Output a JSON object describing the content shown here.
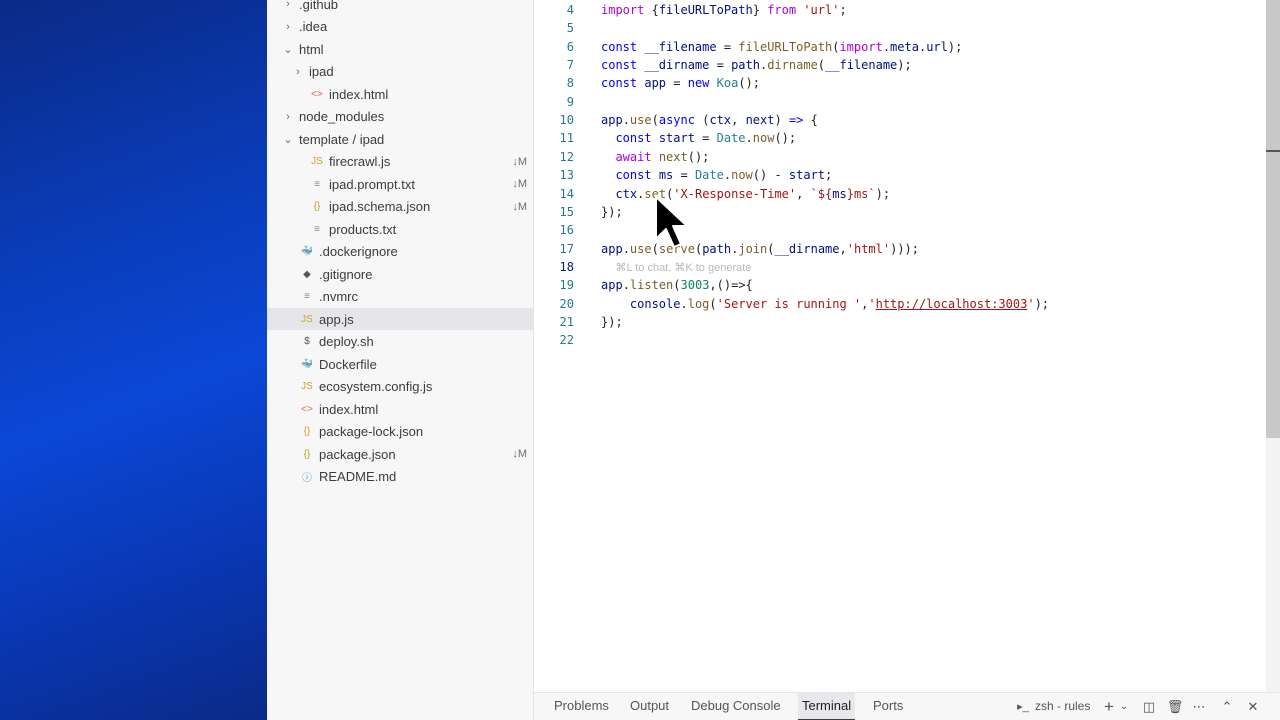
{
  "explorer": {
    "items": [
      {
        "label": ".github",
        "chev": "›",
        "icon": "",
        "status": "",
        "indent": 0
      },
      {
        "label": ".idea",
        "chev": "›",
        "icon": "",
        "status": "",
        "indent": 0
      },
      {
        "label": "html",
        "chev": "⌄",
        "icon": "",
        "status": "",
        "indent": 0
      },
      {
        "label": "ipad",
        "chev": "›",
        "icon": "",
        "status": "",
        "indent": 1
      },
      {
        "label": "index.html",
        "chev": "",
        "icon": "<>",
        "status": "",
        "indent": 1
      },
      {
        "label": "node_modules",
        "chev": "›",
        "icon": "",
        "status": "",
        "indent": 0
      },
      {
        "label": "template / ipad",
        "chev": "⌄",
        "icon": "",
        "status": "",
        "indent": 0
      },
      {
        "label": "firecrawl.js",
        "chev": "",
        "icon": "JS",
        "status": "↓M",
        "indent": 1
      },
      {
        "label": "ipad.prompt.txt",
        "chev": "",
        "icon": "≡",
        "status": "↓M",
        "indent": 1
      },
      {
        "label": "ipad.schema.json",
        "chev": "",
        "icon": "{}",
        "status": "↓M",
        "indent": 1
      },
      {
        "label": "products.txt",
        "chev": "",
        "icon": "≡",
        "status": "",
        "indent": 1
      },
      {
        "label": ".dockerignore",
        "chev": "",
        "icon": "🐳",
        "status": "",
        "indent": 0
      },
      {
        "label": ".gitignore",
        "chev": "",
        "icon": "◆",
        "status": "",
        "indent": 0
      },
      {
        "label": ".nvmrc",
        "chev": "",
        "icon": "≡",
        "status": "",
        "indent": 0
      },
      {
        "label": "app.js",
        "chev": "",
        "icon": "JS",
        "status": "",
        "indent": 0
      },
      {
        "label": "deploy.sh",
        "chev": "",
        "icon": "$",
        "status": "",
        "indent": 0
      },
      {
        "label": "Dockerfile",
        "chev": "",
        "icon": "🐳",
        "status": "",
        "indent": 0
      },
      {
        "label": "ecosystem.config.js",
        "chev": "",
        "icon": "JS",
        "status": "",
        "indent": 0
      },
      {
        "label": "index.html",
        "chev": "",
        "icon": "<>",
        "status": "",
        "indent": 0
      },
      {
        "label": "package-lock.json",
        "chev": "",
        "icon": "{}",
        "status": "",
        "indent": 0
      },
      {
        "label": "package.json",
        "chev": "",
        "icon": "{}",
        "status": "↓M",
        "indent": 0
      },
      {
        "label": "README.md",
        "chev": "",
        "icon": "ⓘ",
        "status": "",
        "indent": 0
      }
    ],
    "selected": "app.js"
  },
  "editor": {
    "lines": [
      {
        "n": "4",
        "tokens": [
          [
            "kw2",
            "import "
          ],
          [
            "",
            "{"
          ],
          [
            "var",
            "fileURLToPath"
          ],
          [
            "",
            "} "
          ],
          [
            "kw2",
            "from "
          ],
          [
            "str",
            "'url'"
          ],
          [
            "",
            ";"
          ]
        ]
      },
      {
        "n": "5",
        "tokens": []
      },
      {
        "n": "6",
        "tokens": [
          [
            "kw",
            "const "
          ],
          [
            "var",
            "__filename"
          ],
          [
            "",
            " = "
          ],
          [
            "fn",
            "fileURLToPath"
          ],
          [
            "",
            "("
          ],
          [
            "kw2",
            "import"
          ],
          [
            "",
            "."
          ],
          [
            "var",
            "meta"
          ],
          [
            "",
            "."
          ],
          [
            "var",
            "url"
          ],
          [
            "",
            ");"
          ]
        ]
      },
      {
        "n": "7",
        "tokens": [
          [
            "kw",
            "const "
          ],
          [
            "var",
            "__dirname"
          ],
          [
            "",
            " = "
          ],
          [
            "var",
            "path"
          ],
          [
            "",
            "."
          ],
          [
            "fn",
            "dirname"
          ],
          [
            "",
            "("
          ],
          [
            "var",
            "__filename"
          ],
          [
            "",
            ");"
          ]
        ]
      },
      {
        "n": "8",
        "tokens": [
          [
            "kw",
            "const "
          ],
          [
            "var",
            "app"
          ],
          [
            "",
            " = "
          ],
          [
            "kw",
            "new "
          ],
          [
            "cls",
            "Koa"
          ],
          [
            "",
            "();"
          ]
        ]
      },
      {
        "n": "9",
        "tokens": []
      },
      {
        "n": "10",
        "tokens": [
          [
            "var",
            "app"
          ],
          [
            "",
            "."
          ],
          [
            "fn",
            "use"
          ],
          [
            "",
            "("
          ],
          [
            "kw",
            "async "
          ],
          [
            "",
            "("
          ],
          [
            "var",
            "ctx"
          ],
          [
            "",
            ", "
          ],
          [
            "var",
            "next"
          ],
          [
            "",
            ") "
          ],
          [
            "kw",
            "=>"
          ],
          [
            "",
            " {"
          ]
        ]
      },
      {
        "n": "11",
        "tokens": [
          [
            "",
            "  "
          ],
          [
            "kw",
            "const "
          ],
          [
            "var",
            "start"
          ],
          [
            "",
            " = "
          ],
          [
            "cls",
            "Date"
          ],
          [
            "",
            "."
          ],
          [
            "fn",
            "now"
          ],
          [
            "",
            "();"
          ]
        ]
      },
      {
        "n": "12",
        "tokens": [
          [
            "",
            "  "
          ],
          [
            "kw2",
            "await "
          ],
          [
            "fn",
            "next"
          ],
          [
            "",
            "();"
          ]
        ]
      },
      {
        "n": "13",
        "tokens": [
          [
            "",
            "  "
          ],
          [
            "kw",
            "const "
          ],
          [
            "var",
            "ms"
          ],
          [
            "",
            " = "
          ],
          [
            "cls",
            "Date"
          ],
          [
            "",
            "."
          ],
          [
            "fn",
            "now"
          ],
          [
            "",
            "() - "
          ],
          [
            "var",
            "start"
          ],
          [
            "",
            ";"
          ]
        ]
      },
      {
        "n": "14",
        "tokens": [
          [
            "",
            "  "
          ],
          [
            "var",
            "ctx"
          ],
          [
            "",
            "."
          ],
          [
            "fn",
            "set"
          ],
          [
            "",
            "("
          ],
          [
            "str",
            "'X-Response-Time'"
          ],
          [
            "",
            ", "
          ],
          [
            "str",
            "`${"
          ],
          [
            "var",
            "ms"
          ],
          [
            "str",
            "}ms`"
          ],
          [
            "",
            ");"
          ]
        ]
      },
      {
        "n": "15",
        "tokens": [
          [
            "",
            "});"
          ]
        ]
      },
      {
        "n": "16",
        "tokens": []
      },
      {
        "n": "17",
        "tokens": [
          [
            "var",
            "app"
          ],
          [
            "",
            "."
          ],
          [
            "fn",
            "use"
          ],
          [
            "",
            "("
          ],
          [
            "fn",
            "serve"
          ],
          [
            "",
            "("
          ],
          [
            "var",
            "path"
          ],
          [
            "",
            "."
          ],
          [
            "fn",
            "join"
          ],
          [
            "",
            "("
          ],
          [
            "var",
            "__dirname"
          ],
          [
            "",
            ","
          ],
          [
            "str",
            "'html'"
          ],
          [
            "",
            ")));"
          ]
        ]
      },
      {
        "n": "18",
        "tokens": [
          [
            "",
            "  "
          ],
          [
            "hint",
            "⌘L to chat, ⌘K to generate"
          ]
        ],
        "active": true
      },
      {
        "n": "19",
        "tokens": [
          [
            "var",
            "app"
          ],
          [
            "",
            "."
          ],
          [
            "fn",
            "listen"
          ],
          [
            "",
            "("
          ],
          [
            "num",
            "3003"
          ],
          [
            "",
            ",()=>{"
          ]
        ]
      },
      {
        "n": "20",
        "tokens": [
          [
            "",
            "    "
          ],
          [
            "var",
            "console"
          ],
          [
            "",
            "."
          ],
          [
            "fn",
            "log"
          ],
          [
            "",
            "("
          ],
          [
            "str",
            "'Server is running '"
          ],
          [
            "",
            ","
          ],
          [
            "str",
            "'"
          ],
          [
            "link",
            "http://localhost:3003"
          ],
          [
            "str",
            "'"
          ],
          [
            "",
            ");"
          ]
        ]
      },
      {
        "n": "21",
        "tokens": [
          [
            "",
            "});"
          ]
        ]
      },
      {
        "n": "22",
        "tokens": []
      }
    ]
  },
  "panel": {
    "tabs": [
      "Problems",
      "Output",
      "Debug Console",
      "Terminal",
      "Ports"
    ],
    "active_tab": "Terminal",
    "terminal_name": "zsh - rules"
  }
}
